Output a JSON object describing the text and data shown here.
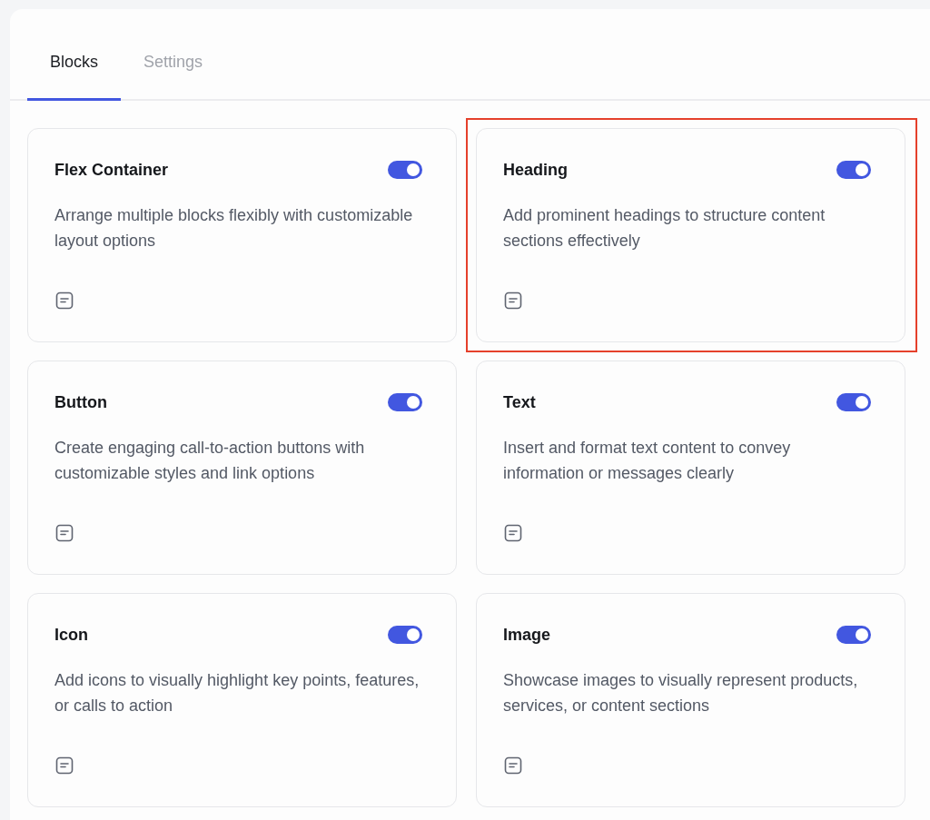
{
  "tabs": [
    {
      "label": "Blocks",
      "selected": true
    },
    {
      "label": "Settings",
      "selected": false
    }
  ],
  "blocks": [
    {
      "title": "Flex Container",
      "description": "Arrange multiple blocks flexibly with customizable layout options",
      "on": true,
      "highlighted": false
    },
    {
      "title": "Heading",
      "description": "Add prominent headings to structure content sections effectively",
      "on": true,
      "highlighted": true
    },
    {
      "title": "Button",
      "description": "Create engaging call-to-action buttons with customizable styles and link options",
      "on": true,
      "highlighted": false
    },
    {
      "title": "Text",
      "description": "Insert and format text content to convey information or messages clearly",
      "on": true,
      "highlighted": false
    },
    {
      "title": "Icon",
      "description": "Add icons to visually highlight key points, features, or calls to action",
      "on": true,
      "highlighted": false
    },
    {
      "title": "Image",
      "description": "Showcase images to visually represent products, services, or content sections",
      "on": true,
      "highlighted": false
    }
  ]
}
